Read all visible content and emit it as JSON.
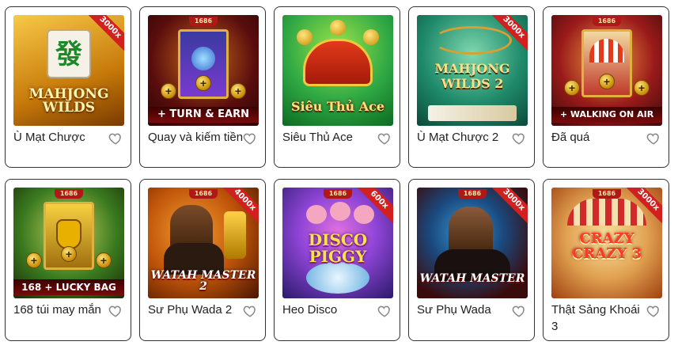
{
  "games": [
    {
      "title": "Ù Mạt Chược",
      "badge": "3000x",
      "tag": "",
      "logo": "MAHJONG WILDS",
      "colors": [
        "#f4b41a",
        "#8a3d00"
      ]
    },
    {
      "title": "Quay và kiếm tiền",
      "badge": "",
      "tag": "1686",
      "logo": "+ TURN & EARN",
      "colors": [
        "#7a1a1a",
        "#2b0a0a"
      ]
    },
    {
      "title": "Siêu Thủ Ace",
      "badge": "",
      "tag": "",
      "logo": "Siêu Thủ Ace",
      "colors": [
        "#2fb34a",
        "#0c6b22"
      ]
    },
    {
      "title": "Ù Mạt Chược 2",
      "badge": "3000x",
      "tag": "",
      "logo": "MAHJONG WILDS 2",
      "colors": [
        "#1f8a6a",
        "#0b4a3a"
      ]
    },
    {
      "title": "Đã quá",
      "badge": "",
      "tag": "1686",
      "logo": "+ WALKING ON AIR",
      "colors": [
        "#c0392b",
        "#3a0b0b"
      ]
    },
    {
      "title": "168 túi may mắn",
      "badge": "",
      "tag": "1686",
      "logo": "168 + LUCKY BAG",
      "colors": [
        "#3a7a1f",
        "#1a2a08"
      ]
    },
    {
      "title": "Sư Phụ Wada 2",
      "badge": "4000x",
      "tag": "1686",
      "logo": "WATAH MASTER 2",
      "colors": [
        "#e0751a",
        "#4a1500"
      ]
    },
    {
      "title": "Heo Disco",
      "badge": "600x",
      "tag": "1686",
      "logo": "DISCO PIGGY",
      "colors": [
        "#8e44d6",
        "#2a1a6a"
      ]
    },
    {
      "title": "Sư Phụ Wada",
      "badge": "3000x",
      "tag": "1686",
      "logo": "WATAH MASTER",
      "colors": [
        "#2a6fb0",
        "#3a0b0b"
      ]
    },
    {
      "title": "Thật Sảng Khoái 3",
      "badge": "3000x",
      "tag": "1686",
      "logo": "CRAZY CRAZY 3",
      "colors": [
        "#f0c060",
        "#a04010"
      ]
    }
  ]
}
